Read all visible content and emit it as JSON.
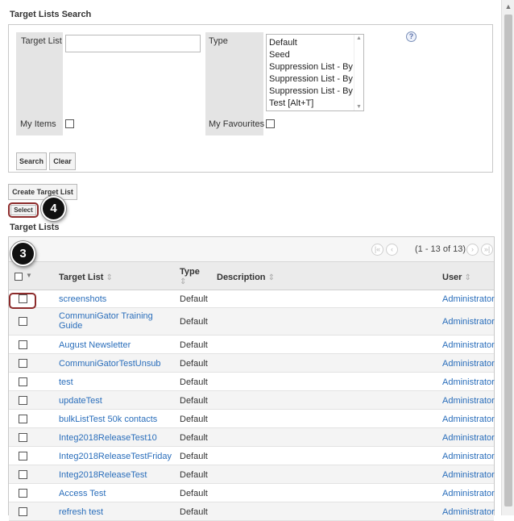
{
  "search": {
    "title": "Target Lists Search",
    "target_list_label": "Target List",
    "target_list_value": "",
    "type_label": "Type",
    "type_options": [
      "Default",
      "Seed",
      "Suppression List - By E",
      "Suppression List - By D",
      "Suppression List - By I",
      "Test [Alt+T]"
    ],
    "my_items_label": "My Items",
    "my_favourites_label": "My Favourites",
    "help_glyph": "?",
    "search_button": "Search",
    "clear_button": "Clear"
  },
  "actions": {
    "create_button": "Create Target List",
    "select_button": "Select"
  },
  "badges": {
    "four": "4",
    "three": "3"
  },
  "table": {
    "title": "Target Lists",
    "pager_text": "(1 - 13 of 13)",
    "headers": {
      "target_list": "Target List",
      "type": "Type",
      "description": "Description",
      "user": "User"
    },
    "rows": [
      {
        "name": "screenshots",
        "type": "Default",
        "description": "",
        "user": "Administrator"
      },
      {
        "name": "CommuniGator Training Guide",
        "type": "Default",
        "description": "",
        "user": "Administrator"
      },
      {
        "name": "August Newsletter",
        "type": "Default",
        "description": "",
        "user": "Administrator"
      },
      {
        "name": "CommuniGatorTestUnsub",
        "type": "Default",
        "description": "",
        "user": "Administrator"
      },
      {
        "name": "test",
        "type": "Default",
        "description": "",
        "user": "Administrator"
      },
      {
        "name": "updateTest",
        "type": "Default",
        "description": "",
        "user": "Administrator"
      },
      {
        "name": "bulkListTest 50k contacts",
        "type": "Default",
        "description": "",
        "user": "Administrator"
      },
      {
        "name": "Integ2018ReleaseTest10",
        "type": "Default",
        "description": "",
        "user": "Administrator"
      },
      {
        "name": "Integ2018ReleaseTestFriday",
        "type": "Default",
        "description": "",
        "user": "Administrator"
      },
      {
        "name": "Integ2018ReleaseTest",
        "type": "Default",
        "description": "",
        "user": "Administrator"
      },
      {
        "name": "Access Test",
        "type": "Default",
        "description": "",
        "user": "Administrator"
      },
      {
        "name": "refresh test",
        "type": "Default",
        "description": "",
        "user": "Administrator"
      }
    ]
  },
  "colors": {
    "link": "#2a6ebb",
    "highlight": "#8c2b2b"
  }
}
